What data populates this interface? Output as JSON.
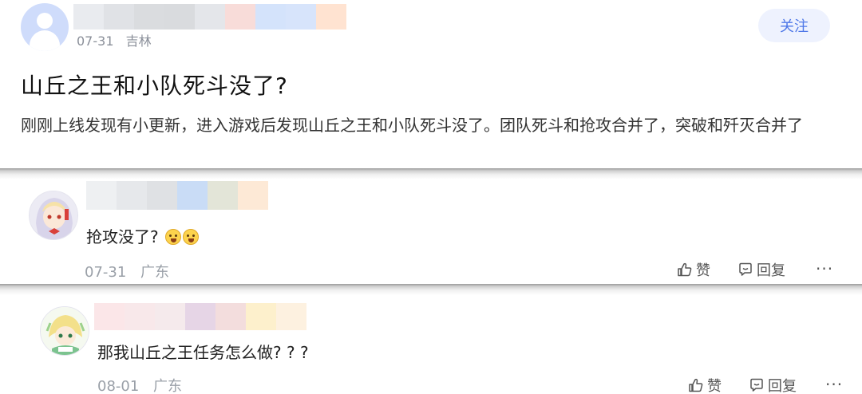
{
  "post": {
    "date": "07-31",
    "location": "吉林",
    "follow_label": "关注",
    "title": "山丘之王和小队死斗没了?",
    "body": "刚刚上线发现有小更新，进入游戏后发现山丘之王和小队死斗没了。团队死斗和抢攻合并了，突破和歼灭合并了",
    "icon": "default-avatar-icon"
  },
  "comments": [
    {
      "text": "抢攻没了?",
      "emojis": [
        "grimace-emoji-icon",
        "grimace-emoji-icon"
      ],
      "date": "07-31",
      "location": "广东",
      "like_label": "赞",
      "reply_label": "回复",
      "more_label": "···"
    },
    {
      "text": "那我山丘之王任务怎么做? ? ?",
      "date": "08-01",
      "location": "广东",
      "like_label": "赞",
      "reply_label": "回复",
      "more_label": "···"
    }
  ],
  "colors": {
    "accent": "#4f78e8",
    "follow_bg": "#eef2fe",
    "meta_gray": "#8a8f99"
  }
}
